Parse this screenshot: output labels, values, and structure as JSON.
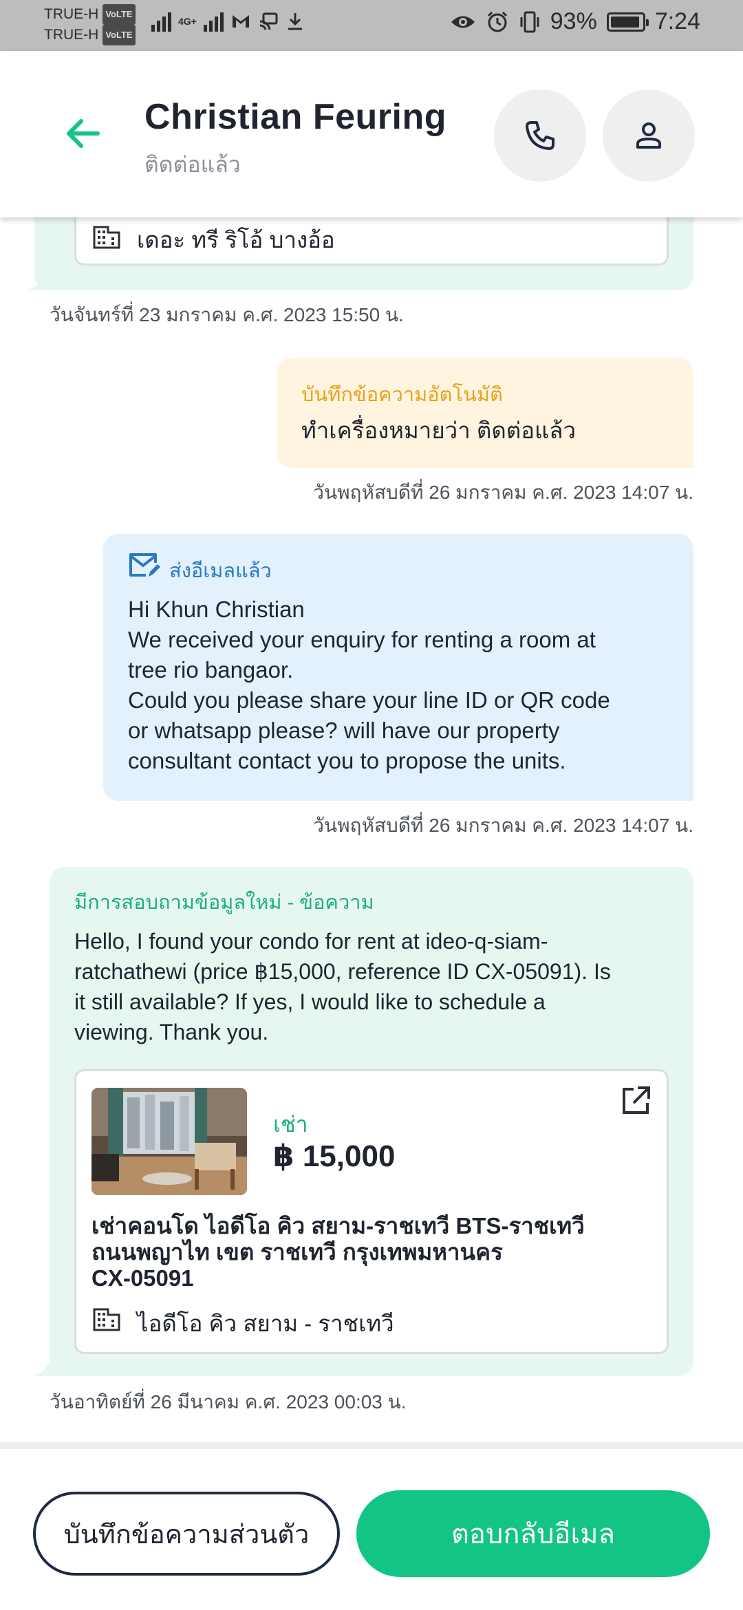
{
  "status_bar": {
    "carrier1": "TRUE-H",
    "carrier2": "TRUE-H",
    "volte": "VoLTE",
    "net": "4G+",
    "battery": "93%",
    "battery_level": 0.93,
    "time": "7:24"
  },
  "header": {
    "name": "Christian Feuring",
    "status": "ติดต่อแล้ว"
  },
  "messages": {
    "top_card_building": "เดอะ ทรี ริโอ้ บางอ้อ",
    "top_timestamp": "วันจันทร์ที่ 23 มกราคม ค.ศ. 2023 15:50 น.",
    "auto_note": {
      "label": "บันทึกข้อความอัตโนมัติ",
      "text": "ทำเครื่องหมายว่า ติดต่อแล้ว",
      "timestamp": "วันพฤหัสบดีที่ 26 มกราคม ค.ศ. 2023 14:07 น."
    },
    "email": {
      "label": "ส่งอีเมลแล้ว",
      "lines": [
        "Hi Khun Christian",
        "We received your enquiry for renting a room at",
        "tree rio bangaor.",
        "Could you please share your line ID or QR code",
        "or whatsapp please? will have our property",
        "consultant contact you to propose the units."
      ],
      "timestamp": "วันพฤหัสบดีที่ 26 มกราคม ค.ศ. 2023 14:07 น."
    },
    "enquiry": {
      "label": "มีการสอบถามข้อมูลใหม่ - ข้อความ",
      "lines": [
        "Hello, I found your condo for rent at ideo-q-siam-",
        "ratchathewi (price ฿15,000, reference ID CX-05091). Is",
        "it still available? If yes, I would like to schedule a",
        "viewing. Thank you."
      ],
      "listing": {
        "type": "เช่า",
        "price": "฿ 15,000",
        "title_lines": [
          "เช่าคอนโด ไอดีโอ คิว สยาม-ราชเทวี BTS-ราชเทวี",
          "ถนนพญาไท เขต ราชเทวี กรุงเทพมหานคร",
          "CX-05091"
        ],
        "building": "ไอดีโอ คิว สยาม - ราชเทวี"
      },
      "timestamp": "วันอาทิตย์ที่ 26 มีนาคม ค.ศ. 2023 00:03 น."
    }
  },
  "actions": {
    "private_note": "บันทึกข้อความส่วนตัว",
    "reply_email": "ตอบกลับอีเมล"
  },
  "colors": {
    "accent_green": "#12c585",
    "navy": "#1f2a44"
  }
}
